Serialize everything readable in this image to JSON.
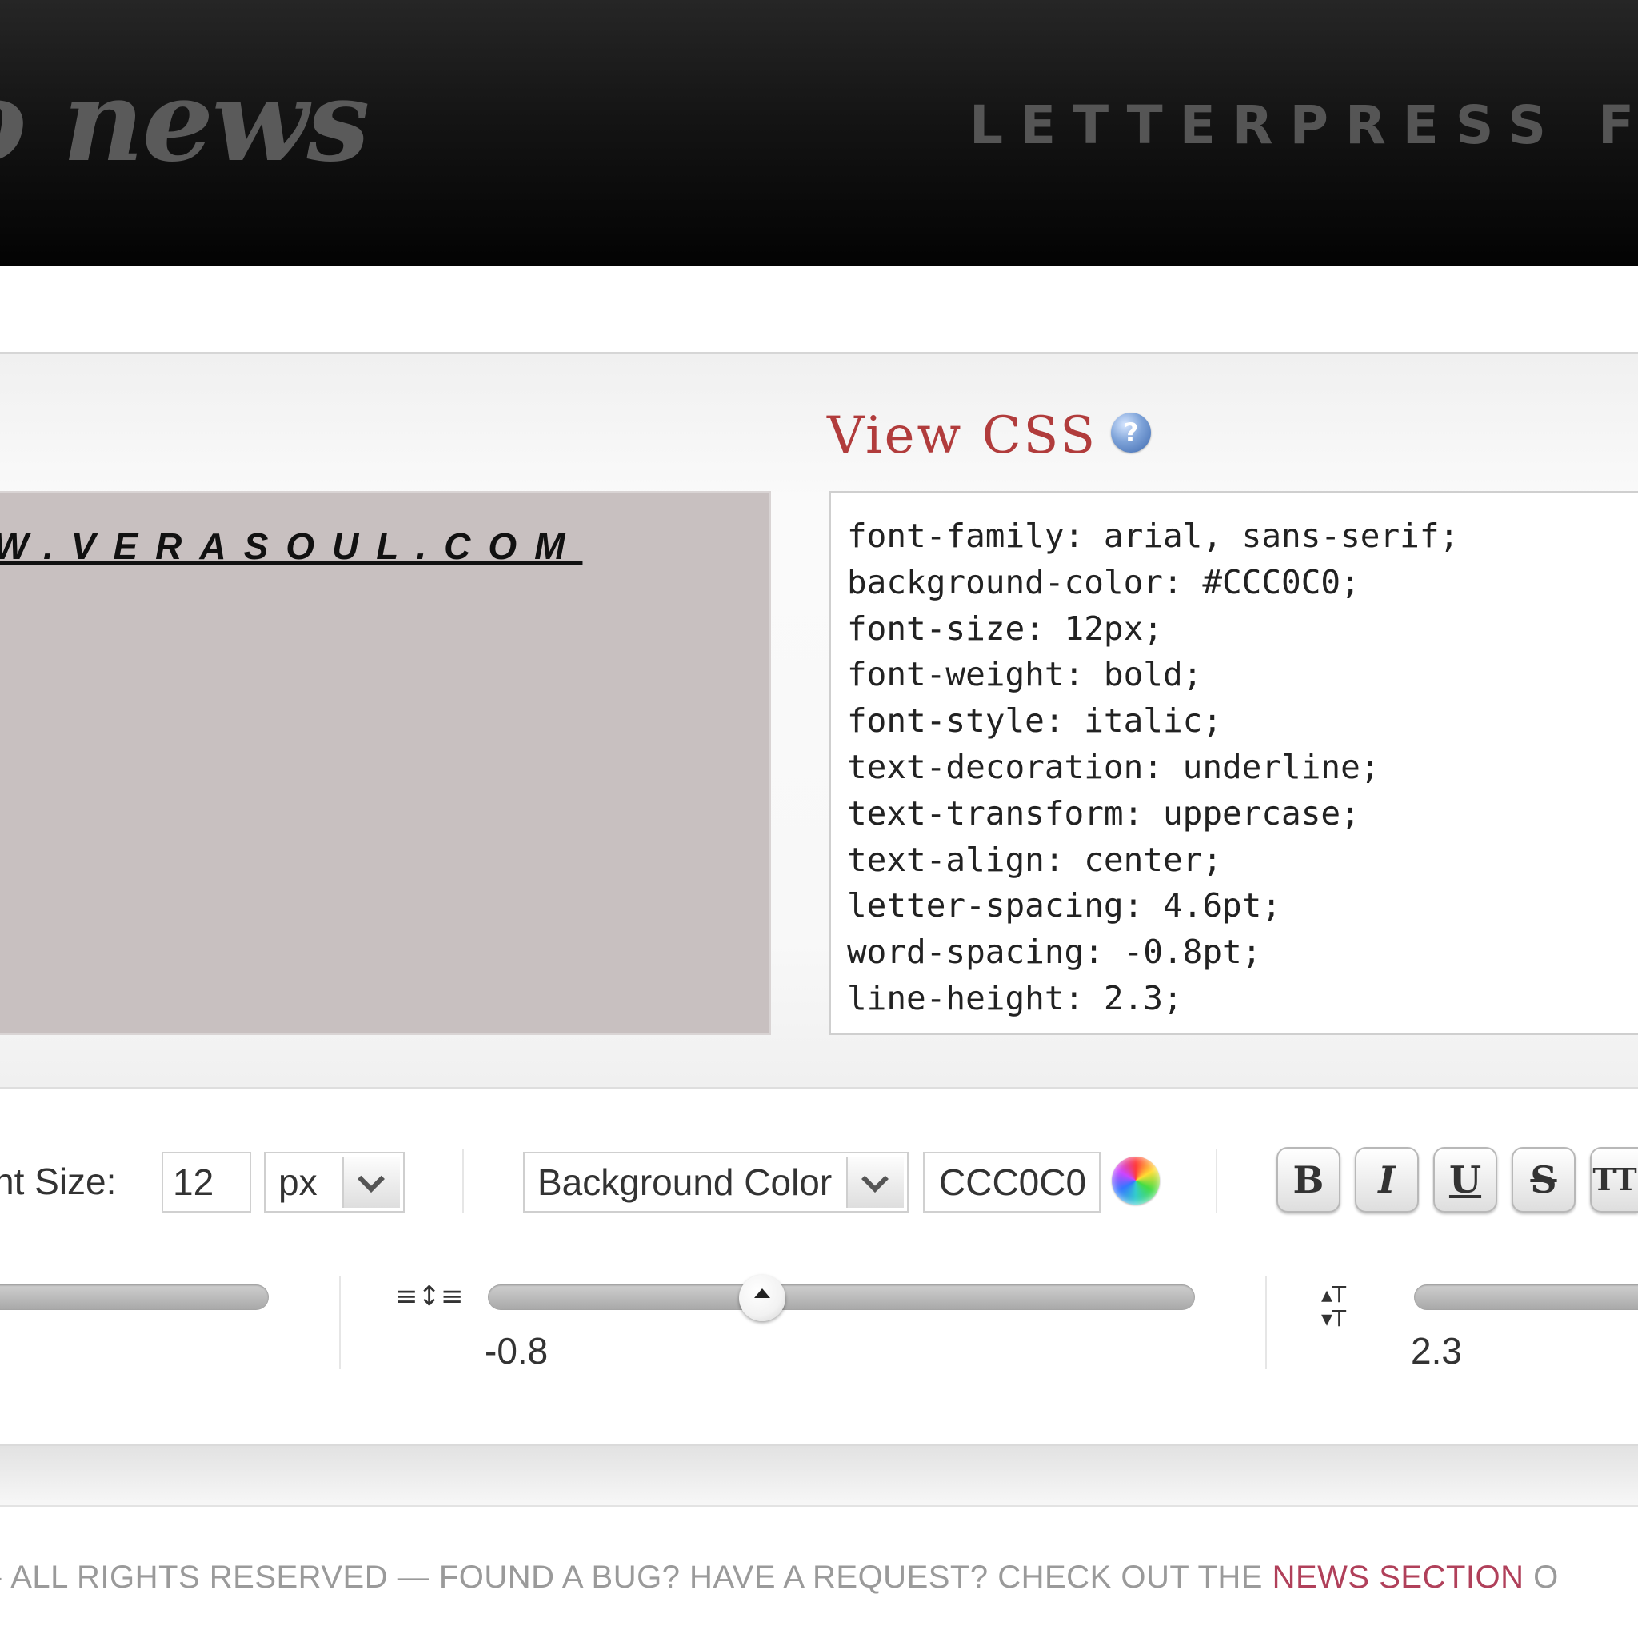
{
  "header": {
    "logo_text": "o news",
    "tagline": "LETTERPRESS FOR T"
  },
  "view_css": {
    "title": "View CSS",
    "help_icon": "question-icon",
    "lines": [
      "font-family: arial, sans-serif;",
      "background-color: #CCC0C0;",
      "font-size: 12px;",
      "font-weight: bold;",
      "font-style: italic;",
      "text-decoration: underline;",
      "text-transform: uppercase;",
      "text-align: center;",
      "letter-spacing: 4.6pt;",
      "word-spacing: -0.8pt;",
      "line-height: 2.3;"
    ]
  },
  "preview": {
    "text": "W.VERASOUL.COM",
    "background": "#C8C0C0"
  },
  "controls": {
    "font_size_label": "nt Size:",
    "font_size_value": "12",
    "unit_select": "px",
    "color_target_select": "Background Color",
    "color_value": "CCC0C0",
    "color_picker_icon": "color-wheel-icon",
    "format_buttons": [
      "B",
      "I",
      "U",
      "S",
      "TT"
    ],
    "word_spacing": {
      "icon": "word-spacing-icon",
      "value": "-0.8"
    },
    "line_height": {
      "icon": "line-height-icon",
      "value": "2.3"
    }
  },
  "footer": {
    "text": "- ALL RIGHTS RESERVED — FOUND A BUG? HAVE A REQUEST? CHECK OUT THE ",
    "link": "NEWS SECTION",
    "tail": " O"
  },
  "colors": {
    "accent_red": "#B13C3C",
    "footer_link": "#B0405A"
  }
}
